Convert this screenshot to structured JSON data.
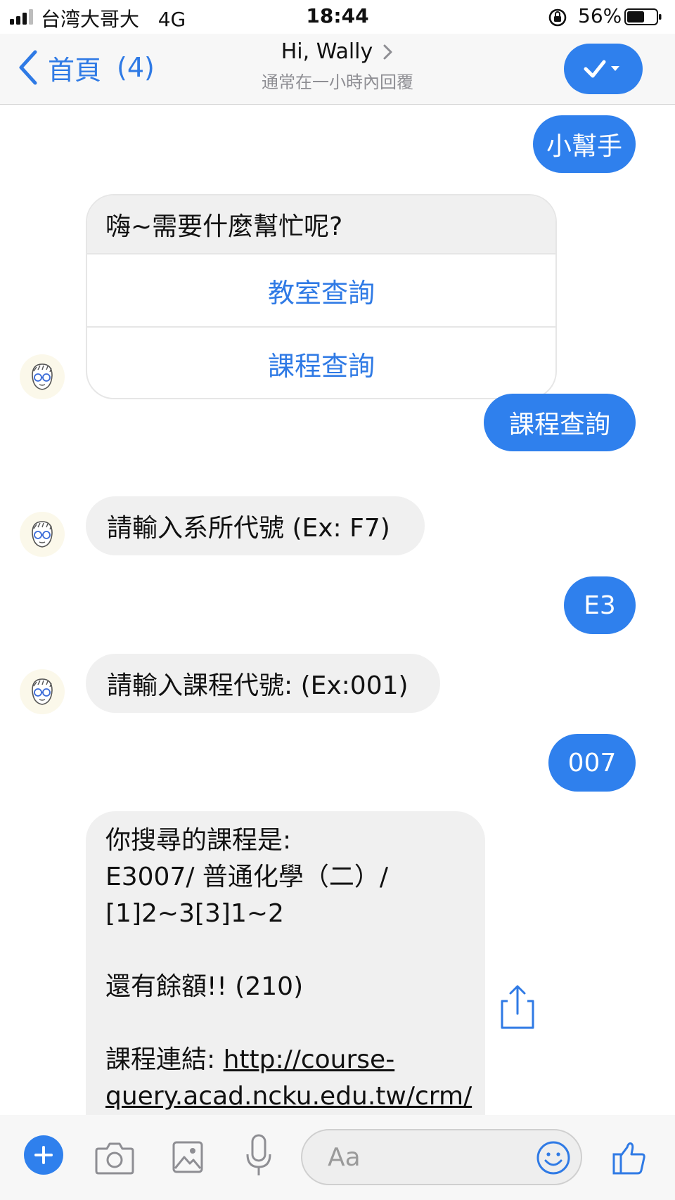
{
  "status_bar": {
    "carrier": "台湾大哥大",
    "network": "4G",
    "time": "18:44",
    "battery": "56%"
  },
  "nav": {
    "back_label": "首頁",
    "back_count": "(4)",
    "title": "Hi, Wally",
    "subtitle": "通常在一小時內回覆"
  },
  "colors": {
    "accent": "#2f80ed",
    "incoming_bubble": "#f0f0f0"
  },
  "messages": {
    "m1": "小幫手",
    "card_text": "嗨~需要什麼幫忙呢?",
    "card_opt1": "教室查詢",
    "card_opt2": "課程查詢",
    "m2": "課程查詢",
    "m3": "請輸入系所代號 (Ex: F7)",
    "m4": "E3",
    "m5": "請輸入課程代號: (Ex:001)",
    "m6": "007",
    "result_l1": "你搜尋的課程是:",
    "result_l2": "E3007/ 普通化學（二）/",
    "result_l3": "[1]2~3[3]1~2",
    "result_l4": "還有餘額!! (210)",
    "result_link_label": "課程連結: ",
    "result_link_part1": "http://course-",
    "result_link_part2": "query.acad.ncku.edu.tw/crm/"
  },
  "composer": {
    "placeholder": "Aa"
  }
}
